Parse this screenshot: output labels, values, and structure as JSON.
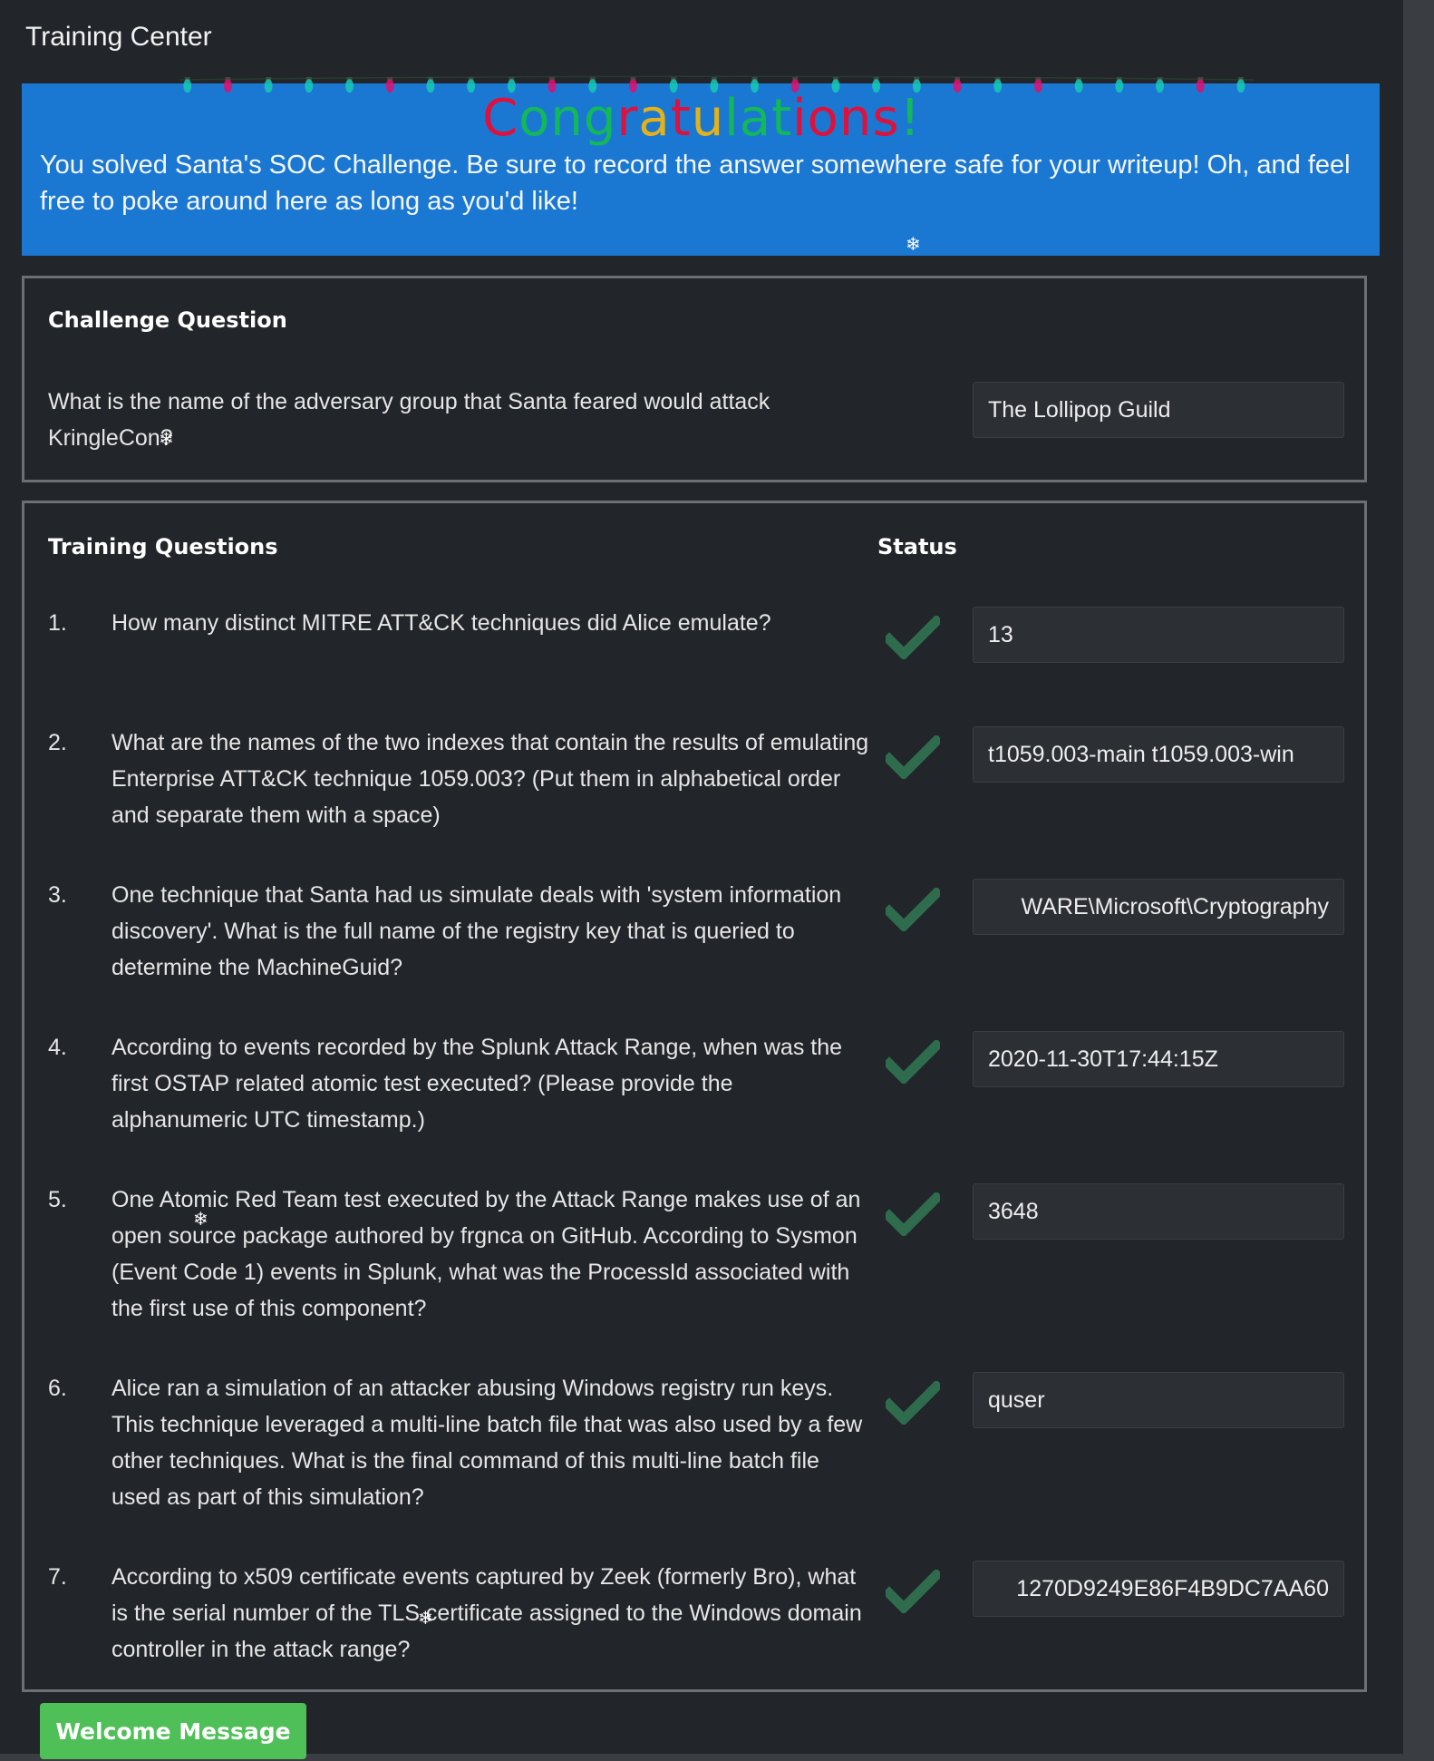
{
  "app": {
    "title": "Training Center"
  },
  "banner": {
    "heading": "Congratulations!",
    "message": "You solved Santa's SOC Challenge. Be sure to record the answer somewhere safe for your writeup! Oh, and feel free to poke around here as long as you'd like!"
  },
  "challenge": {
    "heading": "Challenge Question",
    "question": "What is the name of the adversary group that Santa feared would attack KringleCon?",
    "answer": "The Lollipop Guild"
  },
  "training": {
    "heading": "Training Questions",
    "status_heading": "Status",
    "items": [
      {
        "num": "1.",
        "question": "How many distinct MITRE ATT&CK techniques did Alice emulate?",
        "answer": "13",
        "status": "check-icon"
      },
      {
        "num": "2.",
        "question": "What are the names of the two indexes that contain the results of emulating Enterprise ATT&CK technique 1059.003? (Put them in alphabetical order and separate them with a space)",
        "answer": "t1059.003-main t1059.003-win",
        "status": "check-icon"
      },
      {
        "num": "3.",
        "question": "One technique that Santa had us simulate deals with 'system information discovery'. What is the full name of the registry key that is queried to determine the MachineGuid?",
        "answer": "WARE\\Microsoft\\Cryptography",
        "status": "check-icon"
      },
      {
        "num": "4.",
        "question": "According to events recorded by the Splunk Attack Range, when was the first OSTAP related atomic test executed? (Please provide the alphanumeric UTC timestamp.)",
        "answer": "2020-11-30T17:44:15Z",
        "status": "check-icon"
      },
      {
        "num": "5.",
        "question": "One Atomic Red Team test executed by the Attack Range makes use of an open source package authored by frgnca on GitHub. According to Sysmon (Event Code 1) events in Splunk, what was the ProcessId associated with the first use of this component?",
        "answer": "3648",
        "status": "check-icon"
      },
      {
        "num": "6.",
        "question": "Alice ran a simulation of an attacker abusing Windows registry run keys. This technique leveraged a multi-line batch file that was also used by a few other techniques. What is the final command of this multi-line batch file used as part of this simulation?",
        "answer": "quser",
        "status": "check-icon"
      },
      {
        "num": "7.",
        "question": "According to x509 certificate events captured by Zeek (formerly Bro), what is the serial number of the TLS certificate assigned to the Windows domain controller in the attack range?",
        "answer": "1270D9249E86F4B9DC7AA60",
        "status": "check-icon"
      }
    ]
  },
  "footer": {
    "welcome_button": "Welcome Message"
  },
  "colors": {
    "banner": "#1b78d2",
    "check": "#2f6b4d",
    "button": "#4fbf57",
    "light_pink": "#e0106e",
    "light_teal": "#16c9b4"
  }
}
